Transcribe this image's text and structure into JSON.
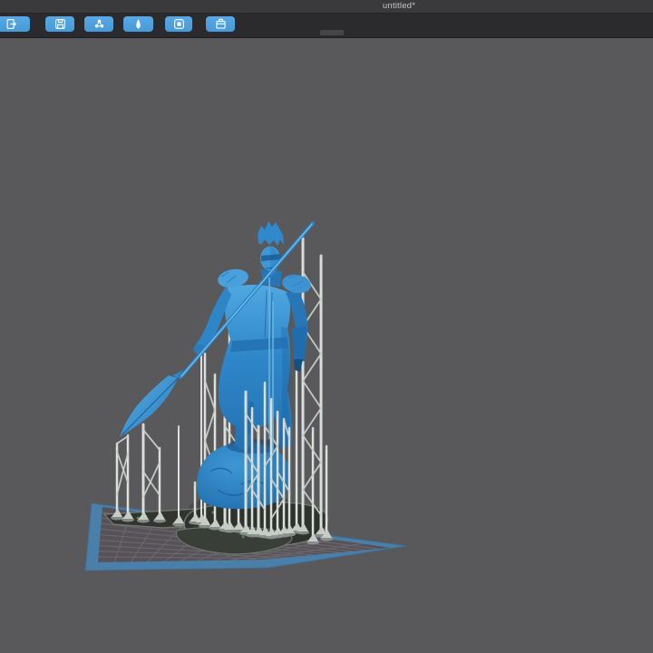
{
  "window": {
    "title": "untitled*"
  },
  "toolbar": {
    "buttons": [
      {
        "name": "import-model",
        "icon": "file-import-icon"
      },
      {
        "name": "save-file",
        "icon": "save-icon"
      },
      {
        "name": "generate-supports",
        "icon": "support-nodes-icon"
      },
      {
        "name": "extruder",
        "icon": "nozzle-icon"
      },
      {
        "name": "build-plate",
        "icon": "plate-icon"
      },
      {
        "name": "print",
        "icon": "printer-icon"
      }
    ]
  },
  "viewport": {
    "background_color": "#59585a",
    "platform_border_color": "#4a7fa9",
    "platform_surface_color": "#565257",
    "grid_line_color": "#6e6a70",
    "raft_color": "#30342f",
    "support_color": "#d4d8d4",
    "support_shade_color": "#c9cfc9",
    "model_color": "#2e86c8",
    "model_highlight_color": "#5ab2e8",
    "model_shadow_color": "#1c64a6"
  }
}
